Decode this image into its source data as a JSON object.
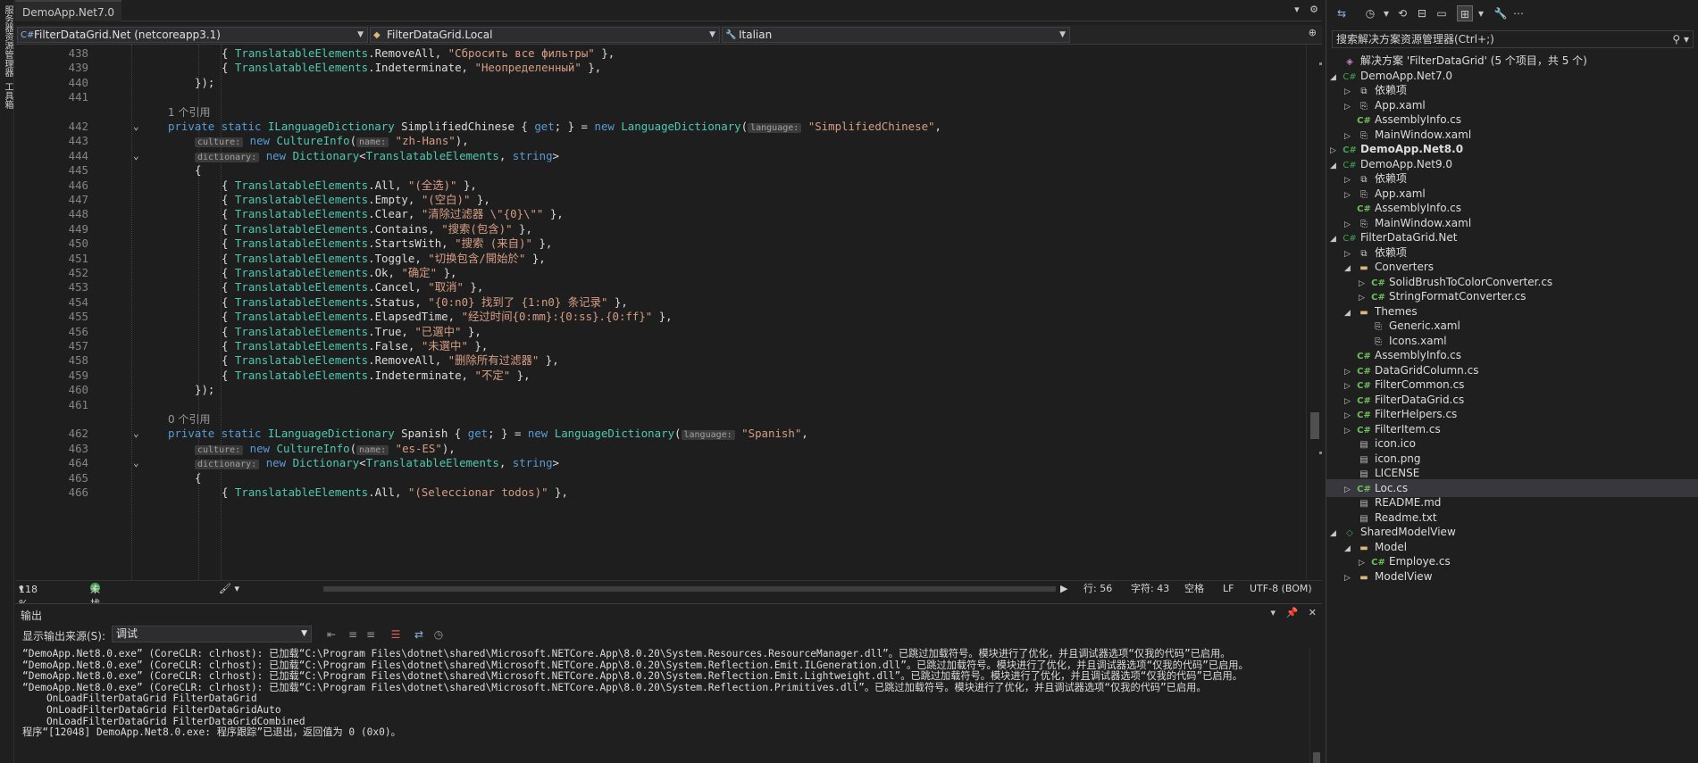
{
  "left_strip": {
    "tab_1": "服务器资源管理器",
    "tab_2": "工具箱"
  },
  "doc_tab": {
    "title": "DemoApp.Net7.0"
  },
  "nav_bar": {
    "project": "FilterDataGrid.Net (netcoreapp3.1)",
    "class": "FilterDataGrid.Local",
    "member": "Italian"
  },
  "code_lines": [
    {
      "num": "438",
      "text": "{ TranslatableElements.RemoveAll, \"Сбросить все фильтры\" },",
      "kind": "entry",
      "indent": 2
    },
    {
      "num": "439",
      "text": "{ TranslatableElements.Indeterminate, \"Неопределенный\" },",
      "kind": "entry",
      "indent": 2
    },
    {
      "num": "440",
      "text": "});",
      "kind": "plain",
      "indent": 1
    },
    {
      "num": "441",
      "text": "",
      "kind": "plain",
      "indent": 0
    },
    {
      "num": "",
      "text": "1 个引用",
      "kind": "ref",
      "indent": 0
    },
    {
      "num": "442",
      "text": "private static ILanguageDictionary SimplifiedChinese { get; } = new LanguageDictionary(",
      "hint": "language:",
      "tail": "\"SimplifiedChinese\",",
      "kind": "decl",
      "indent": 0,
      "fold": "⌄"
    },
    {
      "num": "443",
      "text": "new CultureInfo(",
      "pre": "culture:",
      "hint": "name:",
      "tail": "\"zh-Hans\"),",
      "kind": "ctor",
      "indent": 1
    },
    {
      "num": "444",
      "text": "new Dictionary<TranslatableElements, string>",
      "pre": "dictionary:",
      "kind": "dict",
      "indent": 1,
      "fold": "⌄"
    },
    {
      "num": "445",
      "text": "{",
      "kind": "plain",
      "indent": 1
    },
    {
      "num": "446",
      "text": "{ TranslatableElements.All, \"(全选)\" },",
      "kind": "entry",
      "indent": 2
    },
    {
      "num": "447",
      "text": "{ TranslatableElements.Empty, \"(空白)\" },",
      "kind": "entry",
      "indent": 2
    },
    {
      "num": "448",
      "text": "{ TranslatableElements.Clear, \"清除过滤器 \\\"{0}\\\"\" },",
      "kind": "entry",
      "indent": 2
    },
    {
      "num": "449",
      "text": "{ TranslatableElements.Contains, \"搜索(包含)\" },",
      "kind": "entry",
      "indent": 2
    },
    {
      "num": "450",
      "text": "{ TranslatableElements.StartsWith, \"搜索 (来自)\" },",
      "kind": "entry",
      "indent": 2
    },
    {
      "num": "451",
      "text": "{ TranslatableElements.Toggle, \"切换包含/開始於\" },",
      "kind": "entry",
      "indent": 2
    },
    {
      "num": "452",
      "text": "{ TranslatableElements.Ok, \"确定\" },",
      "kind": "entry",
      "indent": 2
    },
    {
      "num": "453",
      "text": "{ TranslatableElements.Cancel, \"取消\" },",
      "kind": "entry",
      "indent": 2
    },
    {
      "num": "454",
      "text": "{ TranslatableElements.Status, \"{0:n0} 找到了 {1:n0} 条记录\" },",
      "kind": "entry",
      "indent": 2
    },
    {
      "num": "455",
      "text": "{ TranslatableElements.ElapsedTime, \"经过时间{0:mm}:{0:ss}.{0:ff}\" },",
      "kind": "entry",
      "indent": 2
    },
    {
      "num": "456",
      "text": "{ TranslatableElements.True, \"已選中\" },",
      "kind": "entry",
      "indent": 2
    },
    {
      "num": "457",
      "text": "{ TranslatableElements.False, \"未選中\" },",
      "kind": "entry",
      "indent": 2
    },
    {
      "num": "458",
      "text": "{ TranslatableElements.RemoveAll, \"删除所有过滤器\" },",
      "kind": "entry",
      "indent": 2
    },
    {
      "num": "459",
      "text": "{ TranslatableElements.Indeterminate, \"不定\" },",
      "kind": "entry",
      "indent": 2
    },
    {
      "num": "460",
      "text": "});",
      "kind": "plain",
      "indent": 1
    },
    {
      "num": "461",
      "text": "",
      "kind": "plain",
      "indent": 0
    },
    {
      "num": "",
      "text": "0 个引用",
      "kind": "ref",
      "indent": 0
    },
    {
      "num": "462",
      "text": "private static ILanguageDictionary Spanish { get; } = new LanguageDictionary(",
      "hint": "language:",
      "tail": "\"Spanish\",",
      "kind": "decl",
      "indent": 0,
      "fold": "⌄"
    },
    {
      "num": "463",
      "text": "new CultureInfo(",
      "pre": "culture:",
      "hint": "name:",
      "tail": "\"es-ES\"),",
      "kind": "ctor",
      "indent": 1
    },
    {
      "num": "464",
      "text": "new Dictionary<TranslatableElements, string>",
      "pre": "dictionary:",
      "kind": "dict",
      "indent": 1,
      "fold": "⌄"
    },
    {
      "num": "465",
      "text": "{",
      "kind": "plain",
      "indent": 1
    },
    {
      "num": "466",
      "text": "{ TranslatableElements.All, \"(Seleccionar todos)\" },",
      "kind": "entry",
      "indent": 2
    }
  ],
  "status_bar": {
    "zoom": "118 %",
    "issues": "未找到相关问题",
    "line": "行: 56",
    "char": "字符: 43",
    "spaces": "空格",
    "eol": "LF",
    "encoding": "UTF-8 (BOM)"
  },
  "output": {
    "title": "输出",
    "source_label": "显示输出来源(S):",
    "source_value": "调试",
    "lines": [
      "“DemoApp.Net8.0.exe” (CoreCLR: clrhost): 已加载“C:\\Program Files\\dotnet\\shared\\Microsoft.NETCore.App\\8.0.20\\System.Resources.ResourceManager.dll”。已跳过加载符号。模块进行了优化，并且调试器选项“仅我的代码”已启用。",
      "“DemoApp.Net8.0.exe” (CoreCLR: clrhost): 已加载“C:\\Program Files\\dotnet\\shared\\Microsoft.NETCore.App\\8.0.20\\System.Reflection.Emit.ILGeneration.dll”。已跳过加载符号。模块进行了优化，并且调试器选项“仅我的代码”已启用。",
      "“DemoApp.Net8.0.exe” (CoreCLR: clrhost): 已加载“C:\\Program Files\\dotnet\\shared\\Microsoft.NETCore.App\\8.0.20\\System.Reflection.Emit.Lightweight.dll”。已跳过加载符号。模块进行了优化，并且调试器选项“仅我的代码”已启用。",
      "“DemoApp.Net8.0.exe” (CoreCLR: clrhost): 已加载“C:\\Program Files\\dotnet\\shared\\Microsoft.NETCore.App\\8.0.20\\System.Reflection.Primitives.dll”。已跳过加载符号。模块进行了优化，并且调试器选项“仅我的代码”已启用。",
      "    OnLoadFilterDataGrid FilterDataGrid",
      "    OnLoadFilterDataGrid FilterDataGridAuto",
      "    OnLoadFilterDataGrid FilterDataGridCombined",
      "程序“[12048] DemoApp.Net8.0.exe: 程序跟踪”已退出，返回值为 0 (0x0)。"
    ]
  },
  "solution": {
    "search_placeholder": "搜索解决方案资源管理器(Ctrl+;)",
    "items": [
      {
        "label": "解决方案 'FilterDataGrid' (5 个项目，共 5 个)",
        "level": 0,
        "icon": "solution",
        "exp": ""
      },
      {
        "label": "DemoApp.Net7.0",
        "level": 0,
        "icon": "project",
        "exp": "◢"
      },
      {
        "label": "依赖项",
        "level": 1,
        "icon": "dependencies",
        "exp": "▷"
      },
      {
        "label": "App.xaml",
        "level": 1,
        "icon": "xaml",
        "exp": "▷"
      },
      {
        "label": "AssemblyInfo.cs",
        "level": 1,
        "icon": "cs",
        "exp": ""
      },
      {
        "label": "MainWindow.xaml",
        "level": 1,
        "icon": "xaml",
        "exp": "▷"
      },
      {
        "label": "DemoApp.Net8.0",
        "level": 0,
        "icon": "project",
        "exp": "▷",
        "bold": true
      },
      {
        "label": "DemoApp.Net9.0",
        "level": 0,
        "icon": "project",
        "exp": "◢"
      },
      {
        "label": "依赖项",
        "level": 1,
        "icon": "dependencies",
        "exp": "▷"
      },
      {
        "label": "App.xaml",
        "level": 1,
        "icon": "xaml",
        "exp": "▷"
      },
      {
        "label": "AssemblyInfo.cs",
        "level": 1,
        "icon": "cs",
        "exp": ""
      },
      {
        "label": "MainWindow.xaml",
        "level": 1,
        "icon": "xaml",
        "exp": "▷"
      },
      {
        "label": "FilterDataGrid.Net",
        "level": 0,
        "icon": "project",
        "exp": "◢"
      },
      {
        "label": "依赖项",
        "level": 1,
        "icon": "dependencies",
        "exp": "▷"
      },
      {
        "label": "Converters",
        "level": 1,
        "icon": "folder",
        "exp": "◢"
      },
      {
        "label": "SolidBrushToColorConverter.cs",
        "level": 2,
        "icon": "cs",
        "exp": "▷"
      },
      {
        "label": "StringFormatConverter.cs",
        "level": 2,
        "icon": "cs",
        "exp": "▷"
      },
      {
        "label": "Themes",
        "level": 1,
        "icon": "folder",
        "exp": "◢"
      },
      {
        "label": "Generic.xaml",
        "level": 2,
        "icon": "xaml",
        "exp": ""
      },
      {
        "label": "Icons.xaml",
        "level": 2,
        "icon": "xaml",
        "exp": ""
      },
      {
        "label": "AssemblyInfo.cs",
        "level": 1,
        "icon": "cs",
        "exp": ""
      },
      {
        "label": "DataGridColumn.cs",
        "level": 1,
        "icon": "cs",
        "exp": "▷"
      },
      {
        "label": "FilterCommon.cs",
        "level": 1,
        "icon": "cs",
        "exp": "▷"
      },
      {
        "label": "FilterDataGrid.cs",
        "level": 1,
        "icon": "cs",
        "exp": "▷"
      },
      {
        "label": "FilterHelpers.cs",
        "level": 1,
        "icon": "cs",
        "exp": "▷"
      },
      {
        "label": "FilterItem.cs",
        "level": 1,
        "icon": "cs",
        "exp": "▷"
      },
      {
        "label": "icon.ico",
        "level": 1,
        "icon": "file",
        "exp": ""
      },
      {
        "label": "icon.png",
        "level": 1,
        "icon": "file",
        "exp": ""
      },
      {
        "label": "LICENSE",
        "level": 1,
        "icon": "file",
        "exp": ""
      },
      {
        "label": "Loc.cs",
        "level": 1,
        "icon": "cs",
        "exp": "▷",
        "selected": true
      },
      {
        "label": "README.md",
        "level": 1,
        "icon": "file",
        "exp": ""
      },
      {
        "label": "Readme.txt",
        "level": 1,
        "icon": "file",
        "exp": ""
      },
      {
        "label": "SharedModelView",
        "level": 0,
        "icon": "shared",
        "exp": "◢"
      },
      {
        "label": "Model",
        "level": 1,
        "icon": "folder",
        "exp": "◢"
      },
      {
        "label": "Employe.cs",
        "level": 2,
        "icon": "cs",
        "exp": "▷"
      },
      {
        "label": "ModelView",
        "level": 1,
        "icon": "folder",
        "exp": "▷"
      }
    ]
  }
}
